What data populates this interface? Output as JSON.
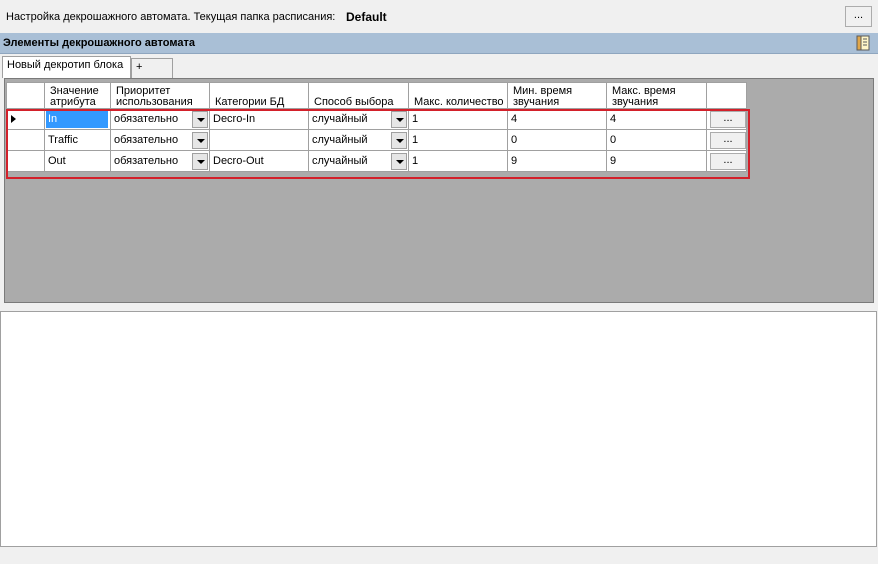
{
  "header": {
    "label": "Настройка декрошажного автомата. Текущая папка расписания:",
    "folder": "Default",
    "more_button": "..."
  },
  "section": {
    "title": "Элементы декрошажного автомата",
    "icon": "book-icon"
  },
  "tabs": [
    {
      "label": "Новый декротип блока",
      "active": true
    },
    {
      "label": "+",
      "active": false
    }
  ],
  "grid": {
    "columns": [
      "Значение атрибута",
      "Приоритет использования",
      "Категории БД",
      "Способ выбора",
      "Макс. количество",
      "Мин. время звучания",
      "Макс. время звучания"
    ],
    "rows": [
      {
        "value": "In",
        "priority": "обязательно",
        "category": "Decro-In",
        "method": "случайный",
        "max_count": "1",
        "min_time": "4",
        "max_time": "4",
        "button": "...",
        "current": true
      },
      {
        "value": "Traffic",
        "priority": "обязательно",
        "category": "",
        "method": "случайный",
        "max_count": "1",
        "min_time": "0",
        "max_time": "0",
        "button": "...",
        "current": false
      },
      {
        "value": "Out",
        "priority": "обязательно",
        "category": "Decro-Out",
        "method": "случайный",
        "max_count": "1",
        "min_time": "9",
        "max_time": "9",
        "button": "...",
        "current": false
      }
    ]
  },
  "colors": {
    "section_header": "#a9bfd6",
    "grid_background": "#ababab",
    "selection": "#3399ff",
    "highlight": "#d3202a"
  }
}
